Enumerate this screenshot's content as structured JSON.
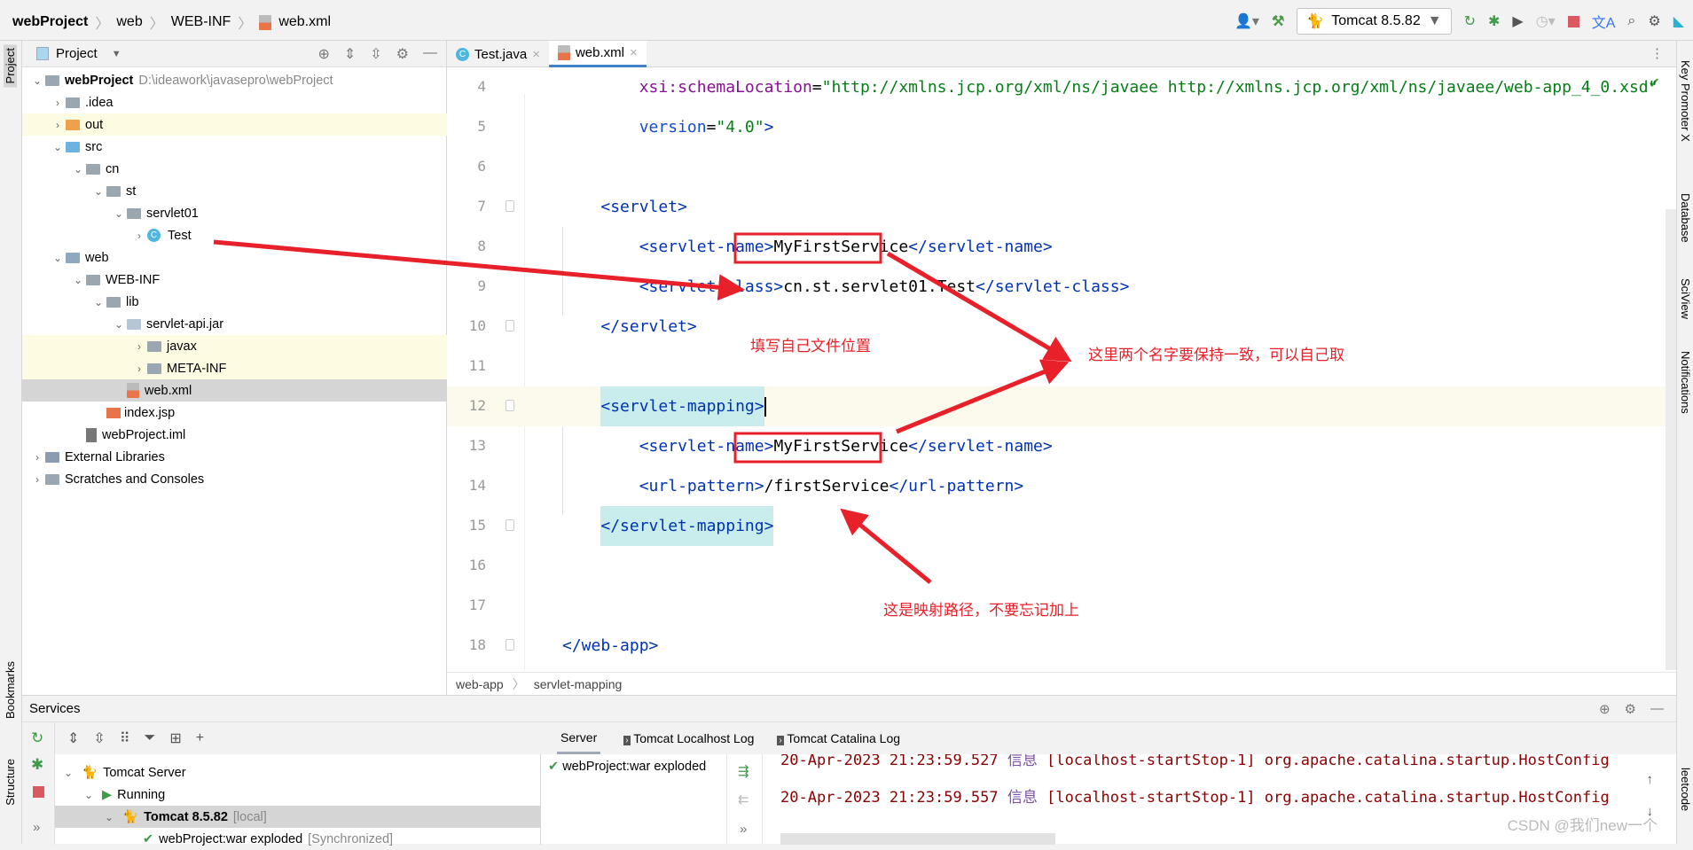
{
  "breadcrumb": [
    "webProject",
    "web",
    "WEB-INF",
    "web.xml"
  ],
  "toolbar": {
    "run_config": "Tomcat 8.5.82",
    "icons": [
      "user-icon",
      "build-hammer-icon",
      "rerun-icon",
      "debug-icon",
      "coverage-icon",
      "profile-icon",
      "stop-icon",
      "translate-icon",
      "search-icon",
      "gear-icon",
      "plugin-icon"
    ]
  },
  "left_strip": {
    "project": "Project",
    "bookmarks": "Bookmarks",
    "structure": "Structure"
  },
  "right_strip": [
    "Key Promoter X",
    "Database",
    "SciView",
    "Notifications",
    "leetcode"
  ],
  "project": {
    "title": "Project",
    "tree": [
      {
        "level": 0,
        "label": "webProject",
        "hint": "D:\\ideawork\\javasepro\\webProject",
        "open": true,
        "bold": true,
        "kind": "module"
      },
      {
        "level": 1,
        "label": ".idea",
        "open": false,
        "kind": "folder"
      },
      {
        "level": 1,
        "label": "out",
        "open": false,
        "kind": "folder-orange",
        "highlight": "#fdfbe2"
      },
      {
        "level": 1,
        "label": "src",
        "open": true,
        "kind": "folder-blue"
      },
      {
        "level": 2,
        "label": "cn",
        "open": true,
        "kind": "package"
      },
      {
        "level": 3,
        "label": "st",
        "open": true,
        "kind": "package"
      },
      {
        "level": 4,
        "label": "servlet01",
        "open": true,
        "kind": "package"
      },
      {
        "level": 5,
        "label": "Test",
        "open": false,
        "kind": "class"
      },
      {
        "level": 1,
        "label": "web",
        "open": true,
        "kind": "folder-web"
      },
      {
        "level": 2,
        "label": "WEB-INF",
        "open": true,
        "kind": "folder"
      },
      {
        "level": 3,
        "label": "lib",
        "open": true,
        "kind": "folder"
      },
      {
        "level": 4,
        "label": "servlet-api.jar",
        "open": true,
        "kind": "jar"
      },
      {
        "level": 5,
        "label": "javax",
        "open": false,
        "kind": "folder",
        "highlight": "#fdfbe2"
      },
      {
        "level": 5,
        "label": "META-INF",
        "open": false,
        "kind": "folder",
        "highlight": "#fdfbe2"
      },
      {
        "level": 4,
        "label": "web.xml",
        "kind": "xml",
        "leaf": true,
        "highlight": "#d5d5d5"
      },
      {
        "level": 3,
        "label": "index.jsp",
        "kind": "jsp",
        "leaf": true
      },
      {
        "level": 2,
        "label": "webProject.iml",
        "kind": "iml",
        "leaf": true
      },
      {
        "level": 0,
        "label": "External Libraries",
        "open": false,
        "kind": "lib"
      },
      {
        "level": 0,
        "label": "Scratches and Consoles",
        "open": false,
        "kind": "scratch"
      }
    ]
  },
  "editor": {
    "tabs": [
      {
        "label": "Test.java",
        "active": false,
        "icon": "java-class-icon"
      },
      {
        "label": "web.xml",
        "active": true,
        "icon": "xml-file-icon"
      }
    ],
    "lines": [
      {
        "n": "4",
        "indent": 8,
        "tokens": [
          [
            "attr",
            "xsi:schemaLocation"
          ],
          [
            "txt",
            "="
          ],
          [
            "val",
            "\"http://xmlns.jcp.org/xml/ns/javaee http://xmlns.jcp.org/xml/ns/javaee/web-app_4_0.xsd\""
          ]
        ]
      },
      {
        "n": "5",
        "indent": 8,
        "tokens": [
          [
            "attr2",
            "version"
          ],
          [
            "txt",
            "="
          ],
          [
            "val",
            "\"4.0\""
          ],
          [
            "tag",
            ">"
          ]
        ]
      },
      {
        "n": "6",
        "indent": 0,
        "tokens": []
      },
      {
        "n": "7",
        "indent": 4,
        "tokens": [
          [
            "tag",
            "<servlet>"
          ]
        ]
      },
      {
        "n": "8",
        "indent": 8,
        "tokens": [
          [
            "tag",
            "<servlet-name>"
          ],
          [
            "txt",
            "MyFirstService"
          ],
          [
            "tag",
            "</servlet-name>"
          ]
        ]
      },
      {
        "n": "9",
        "indent": 8,
        "tokens": [
          [
            "tag",
            "<servlet-class>"
          ],
          [
            "txt",
            "cn.st.servlet01.Test"
          ],
          [
            "tag",
            "</servlet-class>"
          ]
        ]
      },
      {
        "n": "10",
        "indent": 4,
        "tokens": [
          [
            "tag",
            "</servlet>"
          ]
        ]
      },
      {
        "n": "11",
        "indent": 0,
        "tokens": []
      },
      {
        "n": "12",
        "indent": 4,
        "current": true,
        "tokens": [
          [
            "tag hl",
            "<servlet-mapping>"
          ]
        ]
      },
      {
        "n": "13",
        "indent": 8,
        "tokens": [
          [
            "tag",
            "<servlet-name>"
          ],
          [
            "txt",
            "MyFirstService"
          ],
          [
            "tag",
            "</servlet-name>"
          ]
        ]
      },
      {
        "n": "14",
        "indent": 8,
        "tokens": [
          [
            "tag",
            "<url-pattern>"
          ],
          [
            "txt",
            "/firstService"
          ],
          [
            "tag",
            "</url-pattern>"
          ]
        ]
      },
      {
        "n": "15",
        "indent": 4,
        "tokens": [
          [
            "tag hl",
            "</servlet-mapping>"
          ]
        ]
      },
      {
        "n": "16",
        "indent": 0,
        "tokens": []
      },
      {
        "n": "17",
        "indent": 0,
        "tokens": []
      },
      {
        "n": "18",
        "indent": 0,
        "tokens": [
          [
            "tag",
            "</web-app>"
          ]
        ]
      }
    ],
    "breadcrumb": [
      "web-app",
      "servlet-mapping"
    ]
  },
  "annotations": {
    "file_location": "填写自己文件位置",
    "names_match": "这里两个名字要保持一致，可以自己取",
    "mapping_path": "这是映射路径，不要忘记加上",
    "color": "#e8202a"
  },
  "services": {
    "title": "Services",
    "tree": [
      {
        "level": 0,
        "label": "Tomcat Server",
        "icon": "tomcat-icon"
      },
      {
        "level": 1,
        "label": "Running",
        "icon": "run-icon"
      },
      {
        "level": 2,
        "label": "Tomcat 8.5.82",
        "hint": "[local]",
        "icon": "tomcat-icon",
        "selected": true
      },
      {
        "level": 3,
        "label": "webProject:war exploded",
        "hint": "[Synchronized]",
        "icon": "check-icon"
      }
    ],
    "log_tabs": [
      "Server",
      "Tomcat Localhost Log",
      "Tomcat Catalina Log"
    ],
    "deployment": "webProject:war exploded",
    "log_lines": [
      {
        "ts": "20-Apr-2023 21:23:59.527",
        "level": "信息",
        "rest": "[localhost-startStop-1] org.apache.catalina.startup.HostConfig"
      },
      {
        "ts": "20-Apr-2023 21:23:59.557",
        "level": "信息",
        "rest": "[localhost-startStop-1] org.apache.catalina.startup.HostConfig"
      }
    ]
  },
  "watermark": "CSDN @我们new一个"
}
